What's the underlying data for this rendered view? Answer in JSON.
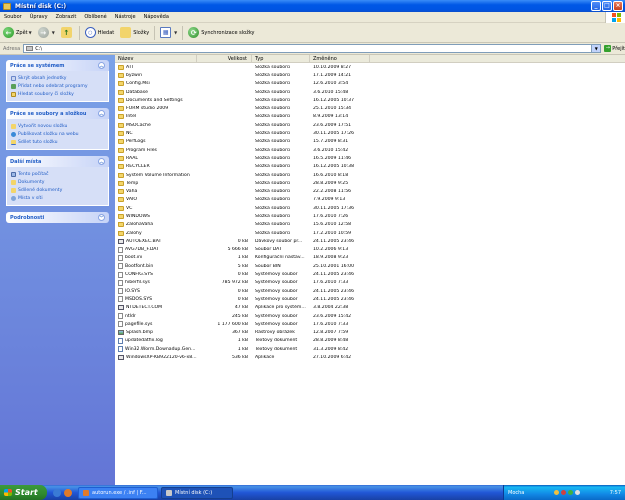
{
  "window": {
    "title": "Místní disk (C:)"
  },
  "menu": [
    "Soubor",
    "Úpravy",
    "Zobrazit",
    "Oblíbené",
    "Nástroje",
    "Nápověda"
  ],
  "toolbar": {
    "back_label": "Zpět",
    "search_label": "Hledat",
    "folders_label": "Složky",
    "sync_label": "Synchronizace složky"
  },
  "address": {
    "label": "Adresa",
    "value": "C:\\",
    "go_label": "Přejít"
  },
  "taskpane": {
    "system": {
      "title": "Práce se systémem",
      "items": [
        "Skrýt obsah jednotky",
        "Přidat nebo odebrat programy",
        "Hledat soubory či složky"
      ]
    },
    "files": {
      "title": "Práce se soubory a složkou",
      "items": [
        "Vytvořit novou složku",
        "Publikovat složku na webu",
        "Sdílet tuto složku"
      ]
    },
    "places": {
      "title": "Další místa",
      "items": [
        "Tento počítač",
        "Dokumenty",
        "Sdílené dokumenty",
        "Místa v síti"
      ]
    },
    "details": {
      "title": "Podrobnosti"
    }
  },
  "columns": {
    "name": "Název",
    "size": "Velikost",
    "type": "Typ",
    "date": "Změněno"
  },
  "files": [
    {
      "icon": "folder",
      "name": "ATI",
      "size": "",
      "type": "Složka souborů",
      "date": "10.10.2009 8:27"
    },
    {
      "icon": "folder",
      "name": "byzwin",
      "size": "",
      "type": "Složka souborů",
      "date": "17.1.2009 14:21"
    },
    {
      "icon": "folder",
      "name": "Config.Msi",
      "size": "",
      "type": "Složka souborů",
      "date": "12.6.2010 3:54"
    },
    {
      "icon": "folder",
      "name": "Database",
      "size": "",
      "type": "Složka souborů",
      "date": "3.6.2010 15:48"
    },
    {
      "icon": "folder",
      "name": "Documents and Settings",
      "size": "",
      "type": "Složka souborů",
      "date": "16.12.2005 10:37"
    },
    {
      "icon": "folder",
      "name": "FORM studio 2009",
      "size": "",
      "type": "Složka souborů",
      "date": "25.1.2010 15:34"
    },
    {
      "icon": "folder",
      "name": "Intel",
      "size": "",
      "type": "Složka souborů",
      "date": "8.9.2009 13:14"
    },
    {
      "icon": "folder",
      "name": "MSOCache",
      "size": "",
      "type": "Složka souborů",
      "date": "23.6.2009 17:51"
    },
    {
      "icon": "folder",
      "name": "NC",
      "size": "",
      "type": "Složka souborů",
      "date": "30.11.2005 17:26"
    },
    {
      "icon": "folder",
      "name": "PerfLogs",
      "size": "",
      "type": "Složka souborů",
      "date": "15.7.2009 8:31"
    },
    {
      "icon": "folder",
      "name": "Program Files",
      "size": "",
      "type": "Složka souborů",
      "date": "3.6.2010 15:42"
    },
    {
      "icon": "folder",
      "name": "RAAL",
      "size": "",
      "type": "Složka souborů",
      "date": "16.5.2009 11:46"
    },
    {
      "icon": "folder",
      "name": "RECYCLER",
      "size": "",
      "type": "Složka souborů",
      "date": "16.12.2005 10:38"
    },
    {
      "icon": "folder",
      "name": "System Volume Information",
      "size": "",
      "type": "Složka souborů",
      "date": "16.6.2010 8:18"
    },
    {
      "icon": "folder",
      "name": "Temp",
      "size": "",
      "type": "Složka souborů",
      "date": "28.8.2009 9:25"
    },
    {
      "icon": "folder",
      "name": "Vaha",
      "size": "",
      "type": "Složka souborů",
      "date": "22.2.2008 11:56"
    },
    {
      "icon": "folder",
      "name": "VAIO",
      "size": "",
      "type": "Složka souborů",
      "date": "7.9.2009 9:13"
    },
    {
      "icon": "folder",
      "name": "VC",
      "size": "",
      "type": "Složka souborů",
      "date": "30.11.2005 17:36"
    },
    {
      "icon": "folder",
      "name": "WINDOWS",
      "size": "",
      "type": "Složka souborů",
      "date": "17.6.2010 7:26"
    },
    {
      "icon": "folder",
      "name": "ZalohaVaha",
      "size": "",
      "type": "Složka souborů",
      "date": "15.6.2010 12:58"
    },
    {
      "icon": "folder",
      "name": "Zalohy",
      "size": "",
      "type": "Složka souborů",
      "date": "17.2.2010 10:59"
    },
    {
      "icon": "app",
      "name": "AUTOEXEC.BAT",
      "size": "0 kB",
      "type": "Dávkový soubor pr...",
      "date": "24.11.2005 23:46"
    },
    {
      "icon": "file",
      "name": "AVG7DB_F.DAT",
      "size": "5 666 kB",
      "type": "Soubor DAT",
      "date": "10.2.2006 9:13"
    },
    {
      "icon": "file",
      "name": "boot.ini",
      "size": "1 kB",
      "type": "Konfigurační nastav...",
      "date": "18.9.2008 9:23"
    },
    {
      "icon": "file",
      "name": "Bootfont.bin",
      "size": "5 kB",
      "type": "Soubor BIN",
      "date": "25.10.2001 16:00"
    },
    {
      "icon": "file",
      "name": "CONFIG.SYS",
      "size": "0 kB",
      "type": "Systémový soubor",
      "date": "24.11.2005 23:46"
    },
    {
      "icon": "file",
      "name": "hiberfil.sys",
      "size": "785 972 kB",
      "type": "Systémový soubor",
      "date": "17.6.2010 7:33"
    },
    {
      "icon": "file",
      "name": "IO.SYS",
      "size": "0 kB",
      "type": "Systémový soubor",
      "date": "24.11.2005 23:46"
    },
    {
      "icon": "file",
      "name": "MSDOS.SYS",
      "size": "0 kB",
      "type": "Systémový soubor",
      "date": "24.11.2005 23:46"
    },
    {
      "icon": "app",
      "name": "NTDETECT.COM",
      "size": "47 kB",
      "type": "Aplikace pro systém...",
      "date": "3.8.2004 22:38"
    },
    {
      "icon": "file",
      "name": "ntldr",
      "size": "245 kB",
      "type": "Systémový soubor",
      "date": "23.6.2009 15:42"
    },
    {
      "icon": "file",
      "name": "pagefile.sys",
      "size": "1 177 600 kB",
      "type": "Systémový soubor",
      "date": "17.6.2010 7:33"
    },
    {
      "icon": "img",
      "name": "Splash.bmp",
      "size": "367 kB",
      "type": "Rastrový obrázek",
      "date": "12.8.2007 7:59"
    },
    {
      "icon": "txt",
      "name": "updatedatfix.log",
      "size": "1 kB",
      "type": "Textový dokument",
      "date": "28.8.2009 8:48"
    },
    {
      "icon": "txt",
      "name": "Win32.Worm.Downadup.Gen...",
      "size": "1 kB",
      "type": "Textový dokument",
      "date": "31.3.2009 8:42"
    },
    {
      "icon": "app",
      "name": "WindowsXP-KB922120-v6-x8...",
      "size": "536 kB",
      "type": "Aplikace",
      "date": "27.10.2009 6:42"
    }
  ],
  "taskbar": {
    "start_label": "Start",
    "tasks": [
      "autorun.exe / .inf | F...",
      "Místní disk (C:)"
    ],
    "tray_text": "Mocha",
    "clock": "7:57"
  }
}
